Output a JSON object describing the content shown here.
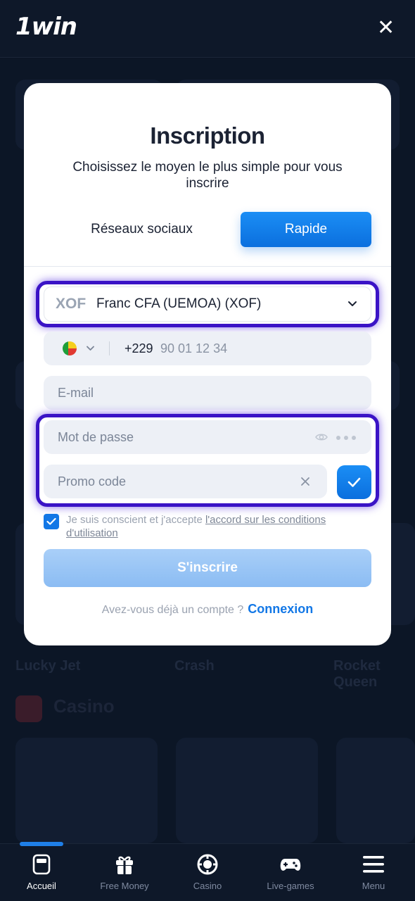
{
  "header": {
    "logo": "1win",
    "close_icon": "close-icon"
  },
  "background": {
    "labels": [
      "Lucky Jet",
      "Crash",
      "Rocket Queen"
    ],
    "section": "Casino"
  },
  "modal": {
    "title": "Inscription",
    "subtitle": "Choisissez le moyen le plus simple pour vous inscrire",
    "tabs": [
      {
        "label": "Réseaux sociaux",
        "active": false
      },
      {
        "label": "Rapide",
        "active": true
      }
    ],
    "currency": {
      "code": "XOF",
      "name": "Franc CFA (UEMOA) (XOF)"
    },
    "phone": {
      "country_code": "+229",
      "placeholder": "90 01 12 34",
      "flag": "benin-flag"
    },
    "email": {
      "placeholder": "E-mail"
    },
    "password": {
      "placeholder": "Mot de passe"
    },
    "promo": {
      "placeholder": "Promo code"
    },
    "terms": {
      "checked": true,
      "text": "Je suis conscient et j'accepte ",
      "link": "l'accord sur les conditions d'utilisation"
    },
    "submit_label": "S'inscrire",
    "login": {
      "question": "Avez-vous déjà un compte ?",
      "link": "Connexion"
    }
  },
  "bottom_nav": {
    "items": [
      {
        "label": "Accueil",
        "icon": "home-icon",
        "active": true
      },
      {
        "label": "Free Money",
        "icon": "gift-icon",
        "active": false
      },
      {
        "label": "Casino",
        "icon": "chip-icon",
        "active": false
      },
      {
        "label": "Live-games",
        "icon": "gamepad-icon",
        "active": false
      },
      {
        "label": "Menu",
        "icon": "menu-icon",
        "active": false
      }
    ]
  },
  "colors": {
    "accent": "#1277e6",
    "highlight": "#3a13c6",
    "background": "#0b1424"
  }
}
